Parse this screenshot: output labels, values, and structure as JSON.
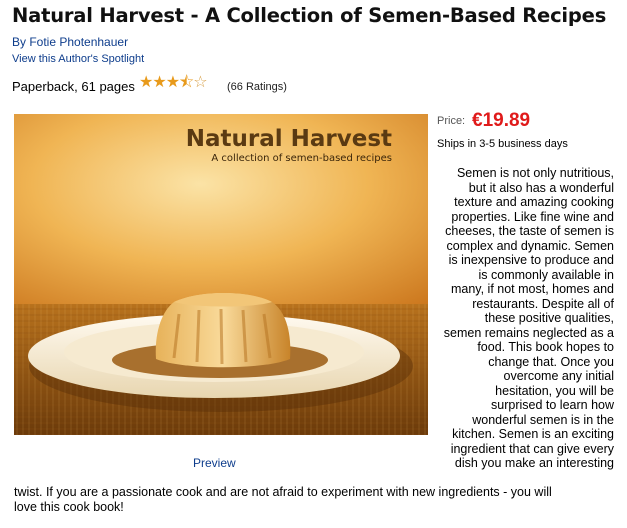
{
  "product": {
    "title": "Natural Harvest - A Collection of Semen-Based Recipes",
    "author": "By Fotie Photenhauer",
    "spotlight_link": "View this Author's Spotlight",
    "format": "Paperback, 61 pages",
    "rating_stars": 3.5,
    "ratings_count": "(66 Ratings)"
  },
  "cover": {
    "title": "Natural Harvest",
    "subtitle": "A collection of semen-based recipes"
  },
  "preview_link": "Preview",
  "price": {
    "label": "Price:",
    "value": "€19.89",
    "shipping": "Ships in 3-5 business days"
  },
  "description": {
    "side_text": "Semen is not only nutritious,\nbut it also has a wonderful\ntexture and amazing cooking\nproperties. Like fine wine and\ncheeses, the taste of semen is\ncomplex and dynamic. Semen\nis inexpensive to produce and\nis commonly available in\nmany, if not most, homes and\nrestaurants. Despite all of\nthese positive qualities,\nsemen remains neglected as a\nfood. This book hopes to\nchange that. Once you\novercome any initial\nhesitation, you will be\nsurprised to learn how\nwonderful semen is in the\nkitchen. Semen is an exciting\ningredient that can give every\ndish you make an interesting",
    "tail_text": "twist. If you are a passionate cook and are not afraid to experiment with new ingredients - you will\nlove this cook book!"
  },
  "colors": {
    "link": "#0e3d8c",
    "price": "#e01a1a",
    "star": "#e89a1b"
  }
}
